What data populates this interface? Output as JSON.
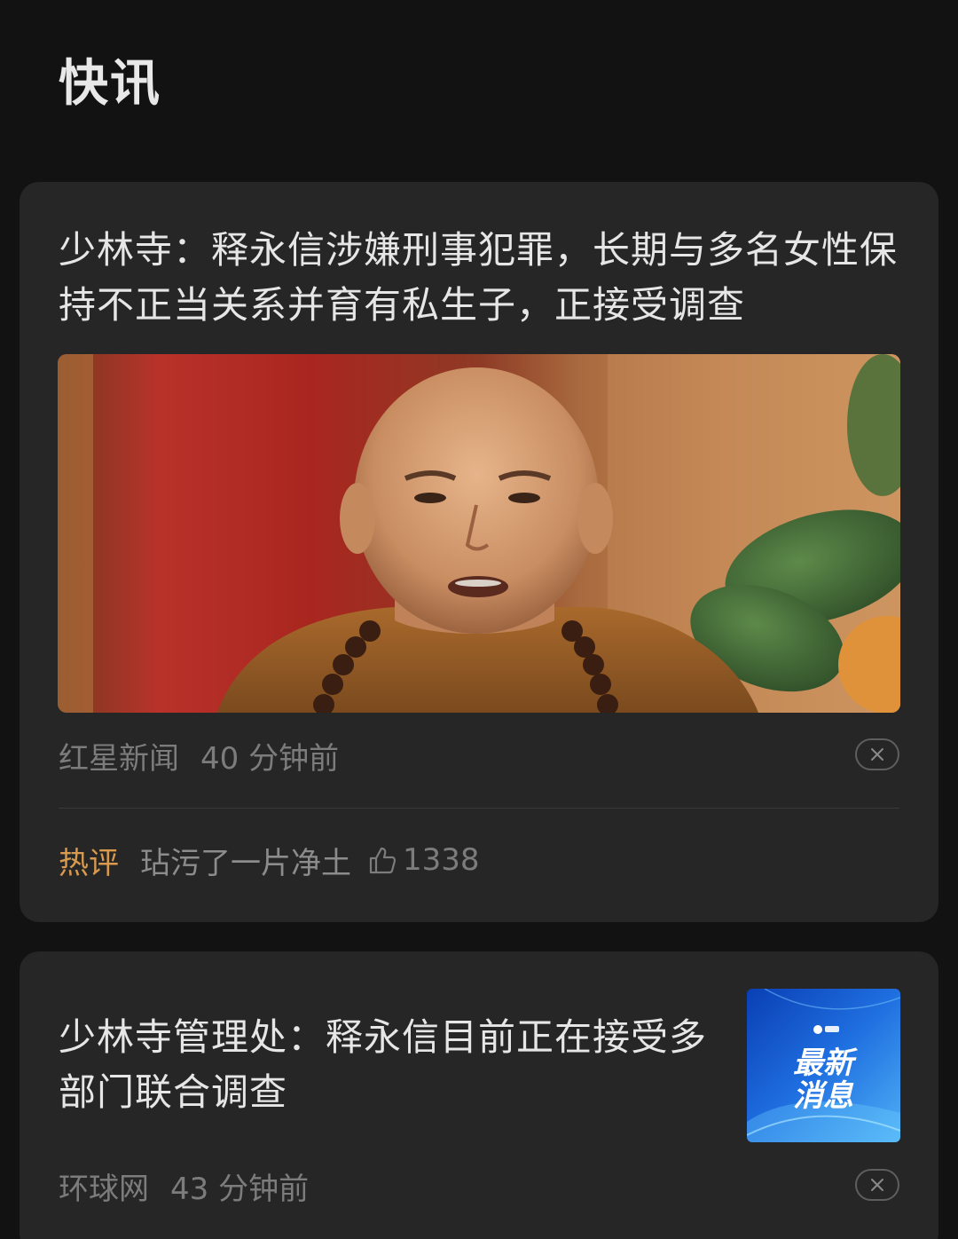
{
  "section": {
    "title": "快讯"
  },
  "articles": [
    {
      "headline": "少林寺：释永信涉嫌刑事犯罪，长期与多名女性保持不正当关系并育有私生子，正接受调查",
      "source": "红星新闻",
      "time": "40 分钟前",
      "image_icon": "monk-portrait-image",
      "hot_comment": {
        "label": "热评",
        "text": "玷污了一片净土",
        "likes": "1338"
      }
    },
    {
      "headline": "少林寺管理处：释永信目前正在接受多部门联合调查",
      "source": "环球网",
      "time": "43 分钟前",
      "thumbnail": {
        "line1": "最新",
        "line2": "消息",
        "icon": "breaking-news-badge"
      }
    }
  ],
  "colors": {
    "background": "#121212",
    "card": "#262626",
    "hot_label": "#d89a4e",
    "thumbnail_blue": "#1f6fe0"
  }
}
